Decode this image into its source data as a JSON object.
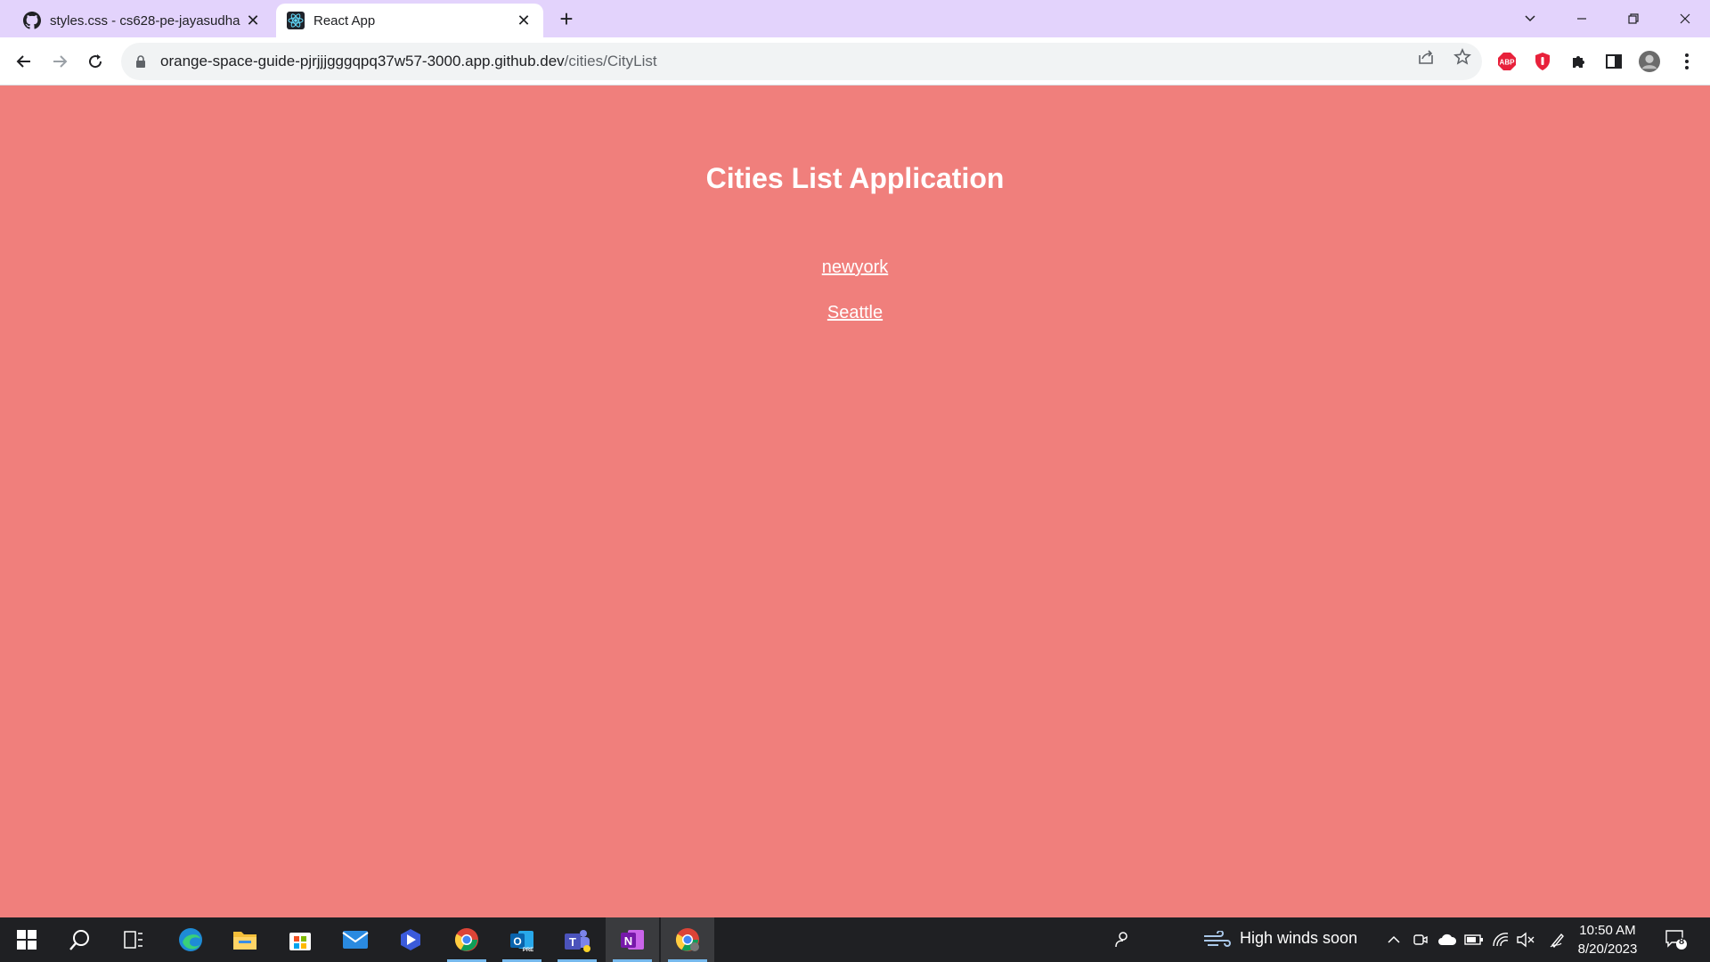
{
  "browser": {
    "tabs": [
      {
        "title": "styles.css - cs628-pe-jayasudha [",
        "icon": "github-icon",
        "active": false
      },
      {
        "title": "React App",
        "icon": "react-icon",
        "active": true
      }
    ],
    "address": {
      "host": "orange-space-guide-pjrjjjgggqpq37w57-3000.app.github.dev",
      "path": "/cities/CityList"
    },
    "extensions": {
      "adblock_label": "ABP"
    }
  },
  "page": {
    "background": "#f07f7c",
    "heading": "Cities List Application",
    "cities": [
      {
        "name": "newyork"
      },
      {
        "name": "Seattle"
      }
    ]
  },
  "taskbar": {
    "weather": "High winds soon",
    "time": "10:50 AM",
    "date": "8/20/2023",
    "notification_count": "8",
    "outlook_badge": "PRE"
  }
}
